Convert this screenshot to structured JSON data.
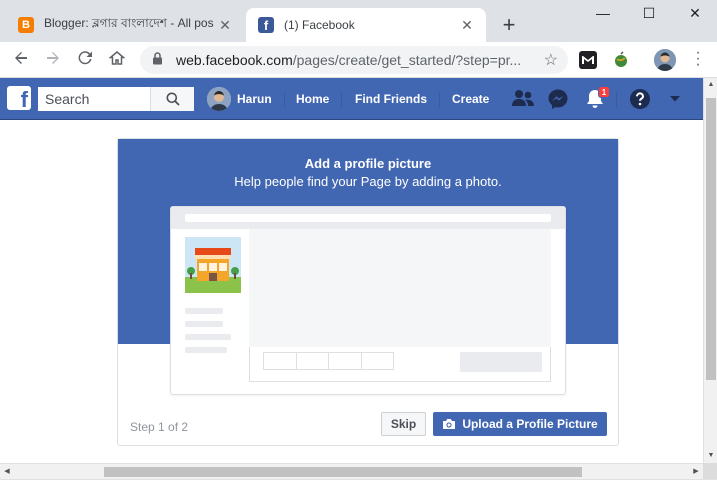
{
  "browser": {
    "tabs": [
      {
        "title": "Blogger: ব্লগার বাংলাদেশ - All pos",
        "favicon": "blogger-icon",
        "active": false
      },
      {
        "title": "(1) Facebook",
        "favicon": "facebook-icon",
        "active": true
      }
    ],
    "new_tab": "+",
    "window_controls": {
      "minimize": "—",
      "maximize": "☐",
      "close": "✕"
    },
    "url_host": "web.facebook.com",
    "url_path": "/pages/create/get_started/?step=pr..."
  },
  "facebook": {
    "search_placeholder": "Search",
    "nav": {
      "user": "Harun",
      "home": "Home",
      "find_friends": "Find Friends",
      "create": "Create"
    },
    "notification_count": "1",
    "brand_color": "#4267b2"
  },
  "dialog": {
    "title": "Add a profile picture",
    "subtitle": "Help people find your Page by adding a photo.",
    "step": "Step 1 of 2",
    "skip": "Skip",
    "upload": "Upload a Profile Picture"
  }
}
